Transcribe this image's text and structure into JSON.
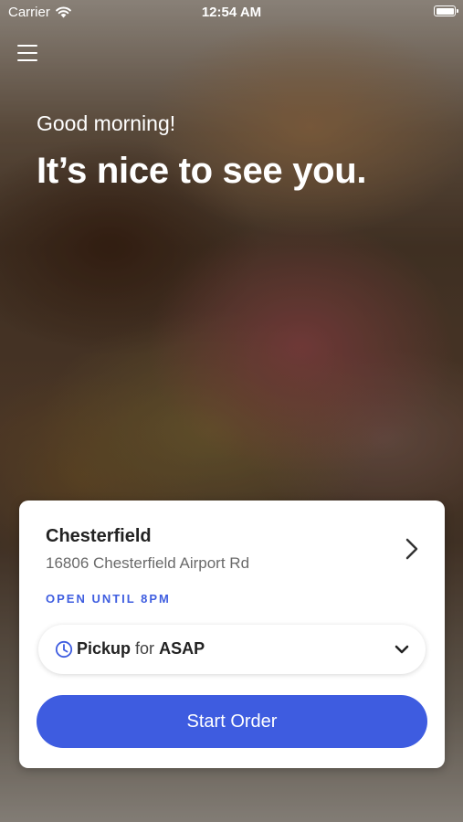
{
  "status_bar": {
    "carrier": "Carrier",
    "time": "12:54 AM"
  },
  "greeting": "Good morning!",
  "headline": "It’s nice to see you.",
  "location": {
    "name": "Chesterfield",
    "address": "16806 Chesterfield Airport Rd",
    "hours": "OPEN UNTIL 8PM"
  },
  "order_mode": {
    "mode": "Pickup",
    "for": "for",
    "time": "ASAP"
  },
  "start_order": "Start Order",
  "colors": {
    "accent": "#3e5ce0"
  },
  "icons": [
    "menu-icon",
    "wifi-icon",
    "battery-icon",
    "chevron-right-icon",
    "clock-icon",
    "chevron-down-icon"
  ]
}
